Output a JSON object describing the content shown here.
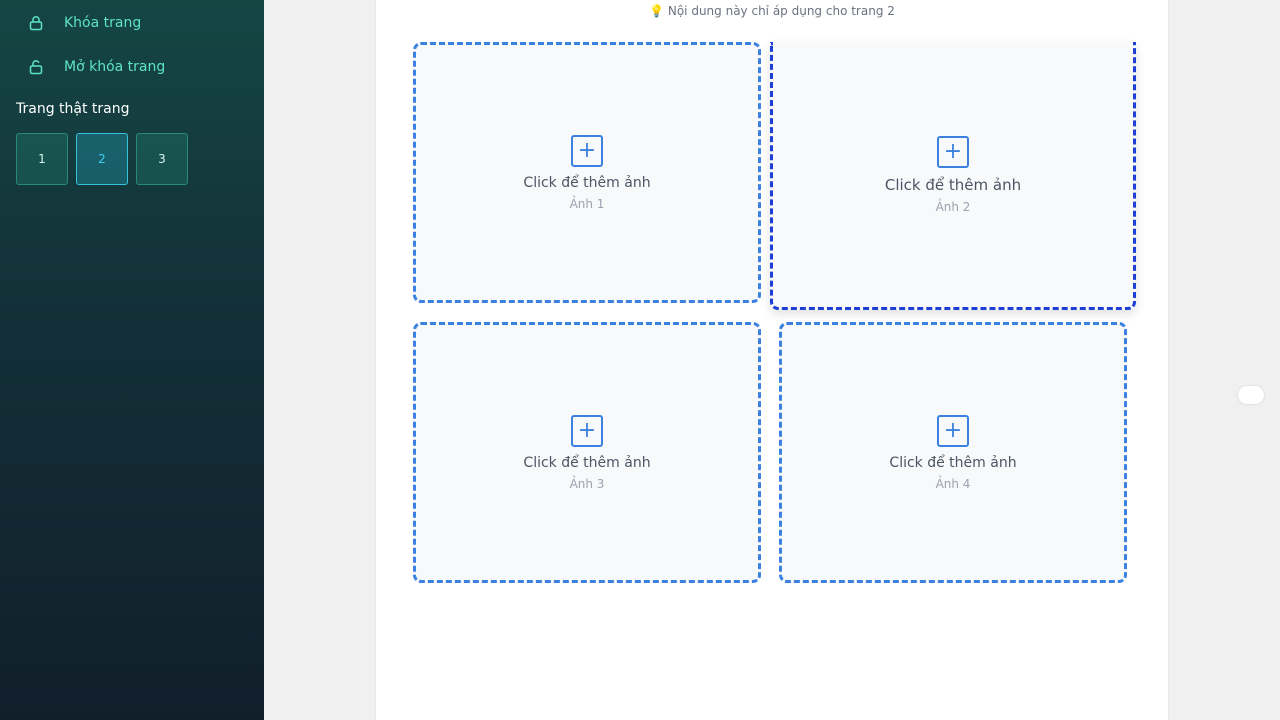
{
  "sidebar": {
    "lock_label": "Khóa trang",
    "unlock_label": "Mở khóa trang",
    "section_title": "Trang thật trang",
    "pages": [
      "1",
      "2",
      "3"
    ],
    "active_page": "2"
  },
  "main": {
    "hint": "💡 Nội dung này chỉ áp dụng cho trang 2",
    "slots": [
      {
        "title": "Click để thêm ảnh",
        "sub": "Ảnh 1"
      },
      {
        "title": "Click để thêm ảnh",
        "sub": "Ảnh 2"
      },
      {
        "title": "Click để thêm ảnh",
        "sub": "Ảnh 3"
      },
      {
        "title": "Click để thêm ảnh",
        "sub": "Ảnh 4"
      }
    ],
    "plus_symbol": "+"
  },
  "colors": {
    "accent": "#3b82e0",
    "sidebar_text": "#5ee3c6",
    "active_page": "#38d2ec"
  }
}
